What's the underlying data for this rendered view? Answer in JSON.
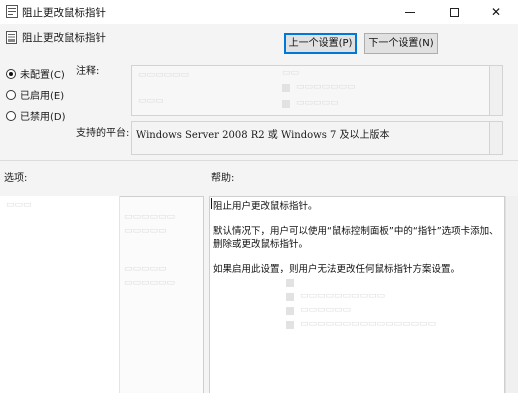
{
  "window": {
    "title": "阻止更改鼠标指针",
    "app_icon": "policy-document-icon",
    "controls": {
      "minimize_icon": "minimize-icon",
      "maximize_icon": "maximize-icon",
      "close_icon": "close-icon",
      "close_glyph": "✕"
    }
  },
  "header": {
    "title": "阻止更改鼠标指针",
    "icon": "policy-setting-icon",
    "prev_button": "上一个设置(P)",
    "next_button": "下一个设置(N)"
  },
  "state_options": [
    {
      "label": "未配置(C)",
      "checked": true
    },
    {
      "label": "已启用(E)",
      "checked": false
    },
    {
      "label": "已禁用(D)",
      "checked": false
    }
  ],
  "comment": {
    "label": "注释:",
    "value": ""
  },
  "supported_on": {
    "label": "支持的平台:",
    "value": "Windows Server 2008 R2 或 Windows 7 及以上版本"
  },
  "options": {
    "label": "选项:"
  },
  "help": {
    "label": "帮助:",
    "paragraphs": [
      "阻止用户更改鼠标指针。",
      "默认情况下，用户可以使用“鼠标控制面板”中的“指针”选项卡添加、",
      "删除或更改鼠标指针。",
      "如果启用此设置，则用户无法更改任何鼠标指针方案设置。"
    ]
  },
  "colors": {
    "accent": "#0078d7",
    "button_bg": "#e1e1e1",
    "window_bg": "#f4f4f4"
  }
}
